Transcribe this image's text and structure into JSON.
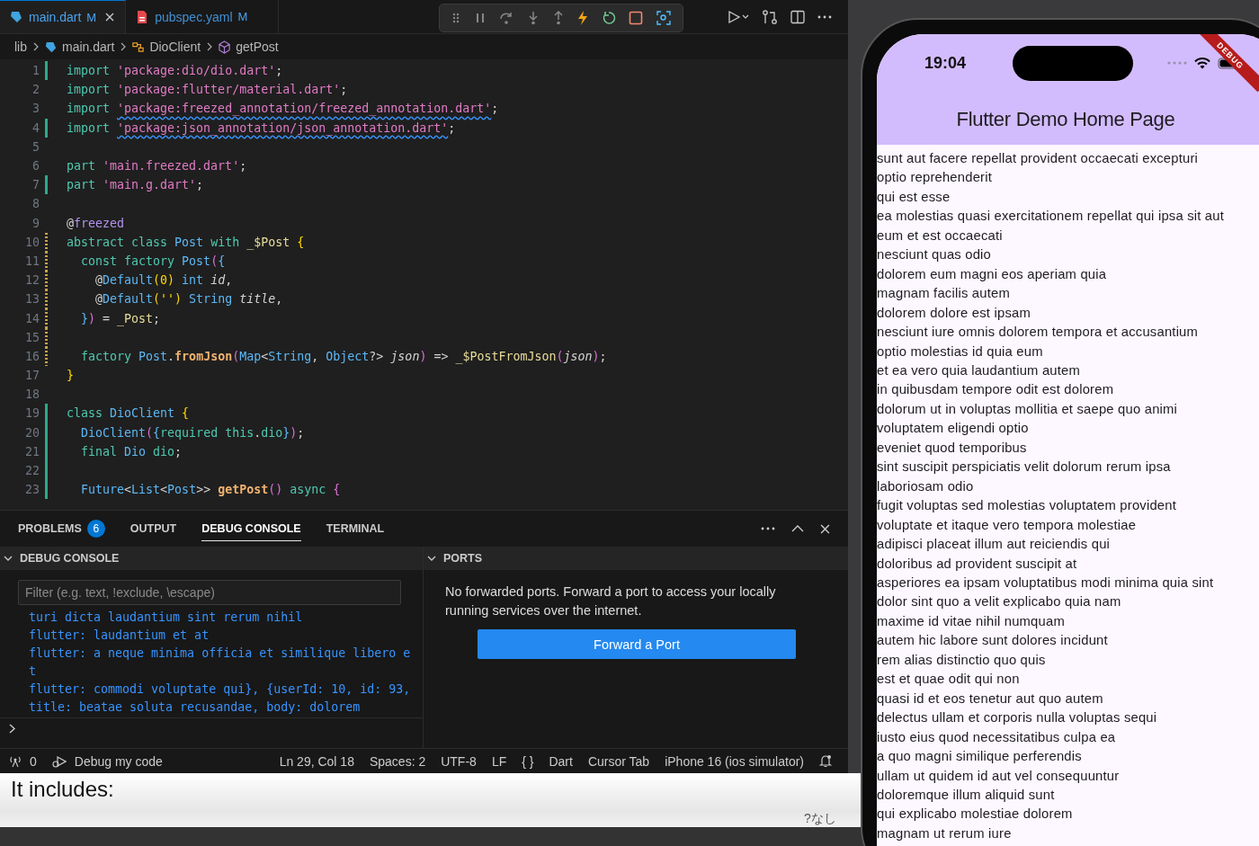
{
  "editor_tabs": [
    {
      "label": "main.dart",
      "badge": "M",
      "selected": true,
      "kind": "dart"
    },
    {
      "label": "pubspec.yaml",
      "badge": "M",
      "selected": false,
      "kind": "yaml"
    }
  ],
  "breadcrumbs": [
    {
      "label": "lib",
      "kind": "folder"
    },
    {
      "label": "main.dart",
      "kind": "dart"
    },
    {
      "label": "DioClient",
      "kind": "class"
    },
    {
      "label": "getPost",
      "kind": "method"
    }
  ],
  "code_lines": [
    {
      "number": "1",
      "kind": "added",
      "tokens": [
        {
          "kind": "kw",
          "text": "import "
        },
        {
          "kind": "str",
          "text": "'package:dio/dio.dart'"
        },
        {
          "kind": "p",
          "text": ";"
        }
      ]
    },
    {
      "number": "2",
      "kind": "plain",
      "tokens": [
        {
          "kind": "kw",
          "text": "import "
        },
        {
          "kind": "str",
          "text": "'package:flutter/material.dart'"
        },
        {
          "kind": "p",
          "text": ";"
        }
      ]
    },
    {
      "number": "3",
      "kind": "plain",
      "tokens": [
        {
          "kind": "kw",
          "text": "import "
        },
        {
          "kind": "warn",
          "text": "'package:freezed_annotation/freezed_annotation.dart'"
        },
        {
          "kind": "p",
          "text": ";"
        }
      ]
    },
    {
      "number": "4",
      "kind": "added",
      "tokens": [
        {
          "kind": "kw",
          "text": "import "
        },
        {
          "kind": "warn",
          "text": "'package:json_annotation/json_annotation.dart'"
        },
        {
          "kind": "p",
          "text": ";"
        }
      ]
    },
    {
      "number": "5",
      "kind": "plain"
    },
    {
      "number": "6",
      "kind": "plain",
      "tokens": [
        {
          "kind": "kw",
          "text": "part "
        },
        {
          "kind": "str",
          "text": "'main.freezed.dart'"
        },
        {
          "kind": "p",
          "text": ";"
        }
      ]
    },
    {
      "number": "7",
      "kind": "added",
      "tokens": [
        {
          "kind": "kw",
          "text": "part "
        },
        {
          "kind": "str",
          "text": "'main.g.dart'"
        },
        {
          "kind": "p",
          "text": ";"
        }
      ]
    },
    {
      "number": "8",
      "kind": "plain"
    },
    {
      "number": "9",
      "kind": "plain",
      "tokens": [
        {
          "kind": "p",
          "text": "@"
        },
        {
          "kind": "anno",
          "text": "freezed"
        }
      ]
    },
    {
      "number": "10",
      "kind": "modified",
      "tokens": [
        {
          "kind": "kw",
          "text": "abstract class "
        },
        {
          "kind": "type",
          "text": "Post "
        },
        {
          "kind": "kw",
          "text": "with "
        },
        {
          "kind": "var",
          "text": "_$Post "
        },
        {
          "kind": "brace",
          "text": "{"
        }
      ]
    },
    {
      "number": "11",
      "kind": "modified",
      "tokens": [
        {
          "kind": "kw",
          "text": "  const factory "
        },
        {
          "kind": "type",
          "text": "Post"
        },
        {
          "kind": "paren",
          "text": "("
        },
        {
          "kind": "type",
          "text": "{"
        }
      ]
    },
    {
      "number": "12",
      "kind": "modified",
      "tokens": [
        {
          "kind": "p",
          "text": "    @"
        },
        {
          "kind": "type",
          "text": "Default"
        },
        {
          "kind": "brace",
          "text": "(0) "
        },
        {
          "kind": "type",
          "text": "int "
        },
        {
          "kind": "it",
          "text": "id"
        },
        {
          "kind": "p",
          "text": ","
        }
      ]
    },
    {
      "number": "13",
      "kind": "modified",
      "tokens": [
        {
          "kind": "p",
          "text": "    @"
        },
        {
          "kind": "type",
          "text": "Default"
        },
        {
          "kind": "brace",
          "text": "('') "
        },
        {
          "kind": "type",
          "text": "String "
        },
        {
          "kind": "it",
          "text": "title"
        },
        {
          "kind": "p",
          "text": ","
        }
      ]
    },
    {
      "number": "14",
      "kind": "modified",
      "tokens": [
        {
          "kind": "type",
          "text": "  }"
        },
        {
          "kind": "paren",
          "text": ")"
        },
        {
          "kind": "p",
          "text": " = "
        },
        {
          "kind": "var",
          "text": "_Post"
        },
        {
          "kind": "p",
          "text": ";"
        }
      ]
    },
    {
      "number": "15",
      "kind": "modified"
    },
    {
      "number": "16",
      "kind": "modified",
      "tokens": [
        {
          "kind": "kw",
          "text": "  factory "
        },
        {
          "kind": "type",
          "text": "Post"
        },
        {
          "kind": "p",
          "text": "."
        },
        {
          "kind": "fn",
          "text": "fromJson"
        },
        {
          "kind": "paren",
          "text": "("
        },
        {
          "kind": "type",
          "text": "Map"
        },
        {
          "kind": "p",
          "text": "<"
        },
        {
          "kind": "type",
          "text": "String"
        },
        {
          "kind": "p",
          "text": ", "
        },
        {
          "kind": "type",
          "text": "Object"
        },
        {
          "kind": "p",
          "text": "?> "
        },
        {
          "kind": "it",
          "text": "json"
        },
        {
          "kind": "paren",
          "text": ")"
        },
        {
          "kind": "p",
          "text": " => "
        },
        {
          "kind": "var",
          "text": "_$PostFromJson"
        },
        {
          "kind": "paren",
          "text": "("
        },
        {
          "kind": "it",
          "text": "json"
        },
        {
          "kind": "paren",
          "text": ")"
        },
        {
          "kind": "p",
          "text": ";"
        }
      ]
    },
    {
      "number": "17",
      "kind": "plain",
      "tokens": [
        {
          "kind": "brace",
          "text": "}"
        }
      ]
    },
    {
      "number": "18",
      "kind": "plain"
    },
    {
      "number": "19",
      "kind": "added",
      "tokens": [
        {
          "kind": "kw",
          "text": "class "
        },
        {
          "kind": "type",
          "text": "DioClient "
        },
        {
          "kind": "brace",
          "text": "{"
        }
      ]
    },
    {
      "number": "20",
      "kind": "added",
      "tokens": [
        {
          "kind": "type",
          "text": "  DioClient"
        },
        {
          "kind": "paren",
          "text": "("
        },
        {
          "kind": "type",
          "text": "{"
        },
        {
          "kind": "kw",
          "text": "required this"
        },
        {
          "kind": "p",
          "text": "."
        },
        {
          "kind": "kw",
          "text": "dio"
        },
        {
          "kind": "type",
          "text": "}"
        },
        {
          "kind": "paren",
          "text": ")"
        },
        {
          "kind": "p",
          "text": ";"
        }
      ]
    },
    {
      "number": "21",
      "kind": "added",
      "tokens": [
        {
          "kind": "kw",
          "text": "  final "
        },
        {
          "kind": "type",
          "text": "Dio "
        },
        {
          "kind": "kw",
          "text": "dio"
        },
        {
          "kind": "p",
          "text": ";"
        }
      ]
    },
    {
      "number": "22",
      "kind": "added"
    },
    {
      "number": "23",
      "kind": "added",
      "tokens": [
        {
          "kind": "type",
          "text": "  Future"
        },
        {
          "kind": "p",
          "text": "<"
        },
        {
          "kind": "type",
          "text": "List"
        },
        {
          "kind": "p",
          "text": "<"
        },
        {
          "kind": "type",
          "text": "Post"
        },
        {
          "kind": "p",
          "text": ">> "
        },
        {
          "kind": "fn",
          "text": "getPost"
        },
        {
          "kind": "paren",
          "text": "() "
        },
        {
          "kind": "kw",
          "text": "async "
        },
        {
          "kind": "paren",
          "text": "{"
        }
      ]
    }
  ],
  "panel_tabs": [
    {
      "label": "PROBLEMS",
      "count": "6",
      "selected": false
    },
    {
      "label": "OUTPUT",
      "selected": false
    },
    {
      "label": "DEBUG CONSOLE",
      "selected": true
    },
    {
      "label": "TERMINAL",
      "selected": false
    }
  ],
  "debug_console": {
    "title": "DEBUG CONSOLE",
    "filter_placeholder": "Filter (e.g. text, !exclude, \\escape)",
    "output": [
      "turi dicta laudantium sint rerum nihil",
      "flutter: laudantium et at",
      "flutter: a neque minima officia et similique libero et",
      "flutter: commodi voluptate qui}, {userId: 10, id: 93, title: beatae soluta recusandae, body: dolorem"
    ]
  },
  "ports": {
    "title": "PORTS",
    "message": "No forwarded ports. Forward a port to access your locally running services over the internet.",
    "button": "Forward a Port"
  },
  "status_bar": {
    "ports_count": "0",
    "debug_label": "Debug my code",
    "items": [
      "Ln 29, Col 18",
      "Spaces: 2",
      "UTF-8",
      "LF",
      "{ }",
      "Dart",
      "Cursor Tab",
      "iPhone 16 (ios simulator)"
    ]
  },
  "background_page": {
    "heading": "It includes:",
    "side_note": "?なし"
  },
  "phone": {
    "time": "19:04",
    "banner": "DEBUG",
    "title": "Flutter Demo Home Page",
    "items": [
      "sunt aut facere repellat provident occaecati excepturi",
      "optio reprehenderit",
      "qui est esse",
      "ea molestias quasi exercitationem repellat qui ipsa sit aut",
      "eum et est occaecati",
      "nesciunt quas odio",
      "dolorem eum magni eos aperiam quia",
      "magnam facilis autem",
      "dolorem dolore est ipsam",
      "nesciunt iure omnis dolorem tempora et accusantium",
      "optio molestias id quia eum",
      "et ea vero quia laudantium autem",
      "in quibusdam tempore odit est dolorem",
      "dolorum ut in voluptas mollitia et saepe quo animi",
      "voluptatem eligendi optio",
      "eveniet quod temporibus",
      "sint suscipit perspiciatis velit dolorum rerum ipsa",
      "laboriosam odio",
      "fugit voluptas sed molestias voluptatem provident",
      "voluptate et itaque vero tempora molestiae",
      "adipisci placeat illum aut reiciendis qui",
      "doloribus ad provident suscipit at",
      "asperiores ea ipsam voluptatibus modi minima quia sint",
      "dolor sint quo a velit explicabo quia nam",
      "maxime id vitae nihil numquam",
      "autem hic labore sunt dolores incidunt",
      "rem alias distinctio quo quis",
      "est et quae odit qui non",
      "quasi id et eos tenetur aut quo autem",
      "delectus ullam et corporis nulla voluptas sequi",
      "iusto eius quod necessitatibus culpa ea",
      "a quo magni similique perferendis",
      "ullam ut quidem id aut vel consequuntur",
      "doloremque illum aliquid sunt",
      "qui explicabo molestiae dolorem",
      "magnam ut rerum iure"
    ]
  }
}
